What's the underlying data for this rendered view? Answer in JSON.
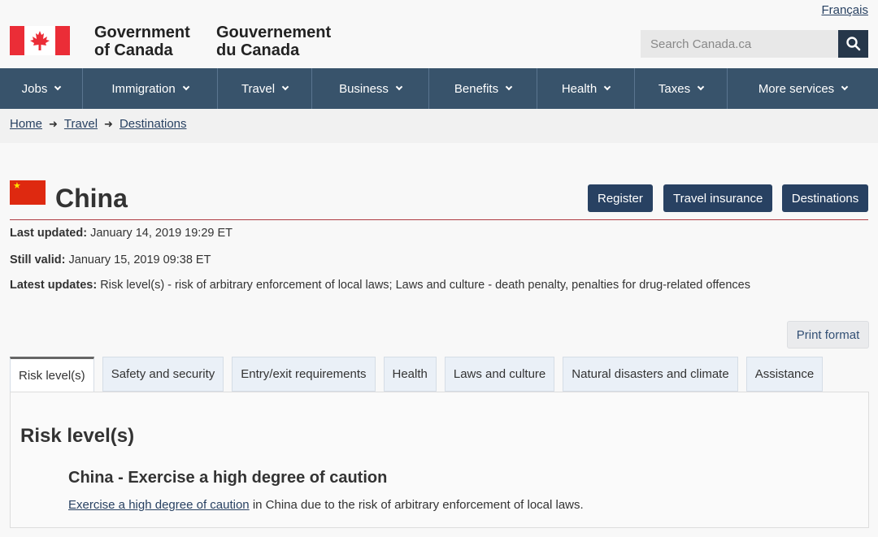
{
  "header": {
    "language_link": "Français",
    "signature_en_line1": "Government",
    "signature_en_line2": "of Canada",
    "signature_fr_line1": "Gouvernement",
    "signature_fr_line2": "du Canada",
    "search_placeholder": "Search Canada.ca",
    "flag_icon": "canada-flag-icon",
    "search_icon": "search-icon"
  },
  "nav": {
    "items": [
      {
        "label": "Jobs"
      },
      {
        "label": "Immigration"
      },
      {
        "label": "Travel"
      },
      {
        "label": "Business"
      },
      {
        "label": "Benefits"
      },
      {
        "label": "Health"
      },
      {
        "label": "Taxes"
      },
      {
        "label": "More services"
      }
    ]
  },
  "breadcrumb": [
    "Home",
    "Travel",
    "Destinations"
  ],
  "page": {
    "title": "China",
    "buttons": [
      "Register",
      "Travel insurance",
      "Destinations"
    ],
    "last_updated_label": "Last updated:",
    "last_updated_value": "January 14, 2019 19:29 ET",
    "still_valid_label": "Still valid:",
    "still_valid_value": "January 15, 2019 09:38 ET",
    "latest_updates_label": "Latest updates:",
    "latest_updates_value": "Risk level(s) - risk of arbitrary enforcement of local laws; Laws and culture - death penalty, penalties for drug-related offences",
    "print_button": "Print format"
  },
  "tabs": [
    {
      "label": "Risk level(s)"
    },
    {
      "label": "Safety and security"
    },
    {
      "label": "Entry/exit requirements"
    },
    {
      "label": "Health"
    },
    {
      "label": "Laws and culture"
    },
    {
      "label": "Natural disasters and climate"
    },
    {
      "label": "Assistance"
    }
  ],
  "panel": {
    "heading": "Risk level(s)",
    "subheading": "China - Exercise a high degree of caution",
    "link_text": "Exercise a high degree of caution",
    "text_after_link": " in China due to the risk of arbitrary enforcement of local laws."
  },
  "colors": {
    "nav_bg": "#38536b",
    "button_bg": "#284162",
    "title_rule": "#af3c43",
    "flag_red": "#eb2d37",
    "china_red": "#de2910"
  }
}
